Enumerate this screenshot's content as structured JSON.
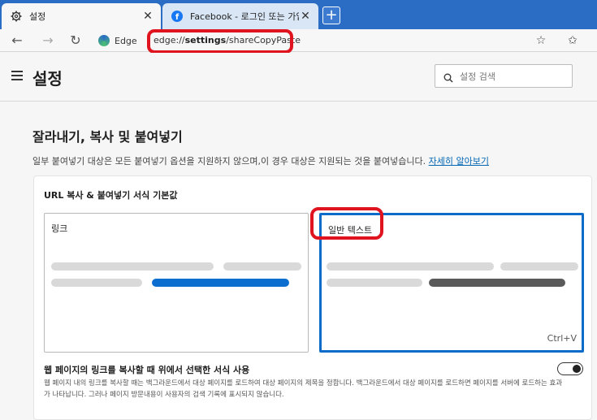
{
  "tabs": [
    {
      "title": "설정",
      "icon": "gear-icon",
      "active": true
    },
    {
      "title": "Facebook - 로그인 또는 가입",
      "icon": "facebook-icon",
      "active": false
    }
  ],
  "toolbar": {
    "site_label": "Edge",
    "url_prefix": "edge://",
    "url_bold": "settings",
    "url_suffix": "/shareCopyPaste"
  },
  "header": {
    "title": "설정",
    "search_placeholder": "설정 검색"
  },
  "section": {
    "title": "잘라내기, 복사 및 붙여넣기",
    "description": "일부 붙여넣기 대상은 모든 붙여넣기 옵션을 지원하지 않으며,이 경우 대상은 지원되는 것을 붙여넣습니다.",
    "learn_more": "자세히 알아보기"
  },
  "card": {
    "heading": "URL 복사 & 붙여넣기 서식 기본값",
    "options": [
      {
        "label": "링크",
        "selected": false
      },
      {
        "label": "일반 텍스트",
        "selected": true,
        "shortcut": "Ctrl+V"
      }
    ],
    "setting_label": "웹 페이지의 링크를 복사할 때 위에서 선택한 서식 사용",
    "setting_desc": "웹 페이지 내의 링크를 복사할 때는 백그라운드에서 대상 페이지를 로드하여 대상 페이지의 제목을 정합니다. 백그라운드에서 대상 페이지를 로드하면 페이지를 서버에 로드하는 효과가 나타납니다. 그러나 페이지 방문내용이 사용자의 검색 기록에 표시되지 않습니다.",
    "toggle_on": false
  },
  "colors": {
    "accent": "#0a6bc8",
    "tabstrip": "#2b6cc4",
    "annotation_red": "#e0141e"
  }
}
